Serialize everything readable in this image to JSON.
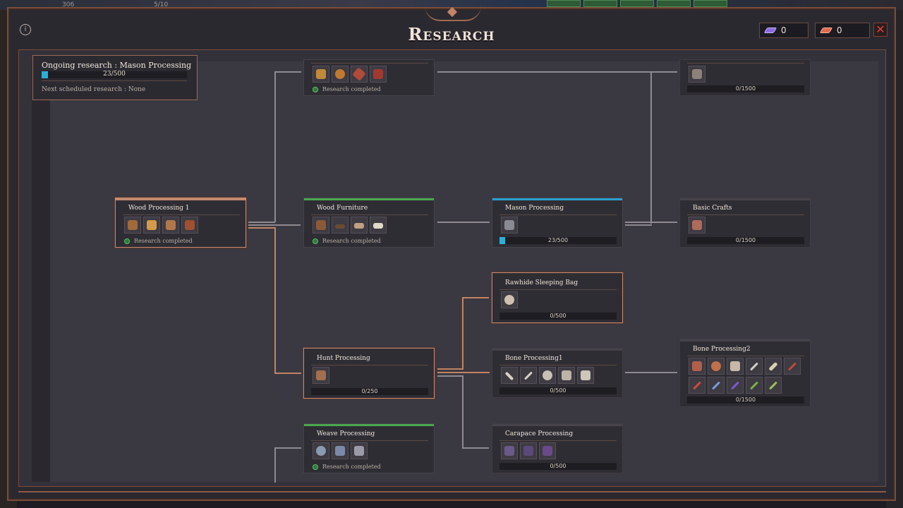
{
  "hud": {
    "count_a": "306",
    "count_b": "5/10"
  },
  "window": {
    "title": "Research"
  },
  "currencies": [
    {
      "icon": "purple-gem-icon",
      "value": "0",
      "color": "#8c6ae0"
    },
    {
      "icon": "red-gem-icon",
      "value": "0",
      "color": "#e06a50"
    }
  ],
  "ongoing": {
    "label": "Ongoing research : Mason Processing",
    "progress_text": "23/500",
    "progress": 0.046,
    "next": "Next scheduled research : None"
  },
  "nodes": {
    "top_center": {
      "status": "Research completed"
    },
    "top_right": {
      "progress_text": "0/1500"
    },
    "wood1": {
      "name": "Wood Processing 1",
      "status": "Research completed"
    },
    "furniture": {
      "name": "Wood Furniture",
      "status": "Research completed"
    },
    "mason": {
      "name": "Mason Processing",
      "progress_text": "23/500",
      "progress": 0.046
    },
    "crafts": {
      "name": "Basic Crafts",
      "progress_text": "0/1500"
    },
    "rawhide": {
      "name": "Rawhide Sleeping Bag",
      "progress_text": "0/500"
    },
    "hunt": {
      "name": "Hunt Processing",
      "progress_text": "0/250"
    },
    "bone1": {
      "name": "Bone Processing1",
      "progress_text": "0/500"
    },
    "bone2": {
      "name": "Bone Processing2",
      "progress_text": "0/1500"
    },
    "weave": {
      "name": "Weave Processing",
      "status": "Research completed"
    },
    "carapace": {
      "name": "Carapace Processing",
      "progress_text": "0/500"
    }
  },
  "colors": {
    "completed": "#4aa84e",
    "in_progress": "#2aa0d0",
    "selected": "#c48a70",
    "close": "#e0403a"
  }
}
